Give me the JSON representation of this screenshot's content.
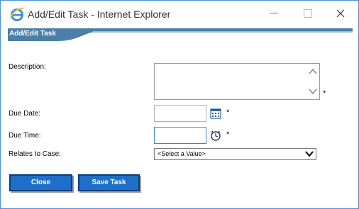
{
  "window": {
    "title": "Add/Edit Task - Internet Explorer"
  },
  "header": {
    "title": "Add/Edit Task"
  },
  "form": {
    "description_label": "Description:",
    "due_date_label": "Due Date:",
    "due_time_label": "Due Time:",
    "relates_label": "Relates to Case:",
    "required_mark": "*",
    "description_value": "",
    "due_date_value": "",
    "due_time_value": "",
    "relates_selected": "<Select a Value>"
  },
  "buttons": {
    "close_label": "Close",
    "save_label": "Save Task"
  },
  "colors": {
    "accent": "#1e6fc9",
    "header_bar": "#4a7fa8"
  },
  "icons": [
    "ie-logo-icon",
    "minimize-icon",
    "maximize-icon",
    "close-icon",
    "calendar-icon",
    "clock-icon",
    "chevron-down-icon"
  ]
}
